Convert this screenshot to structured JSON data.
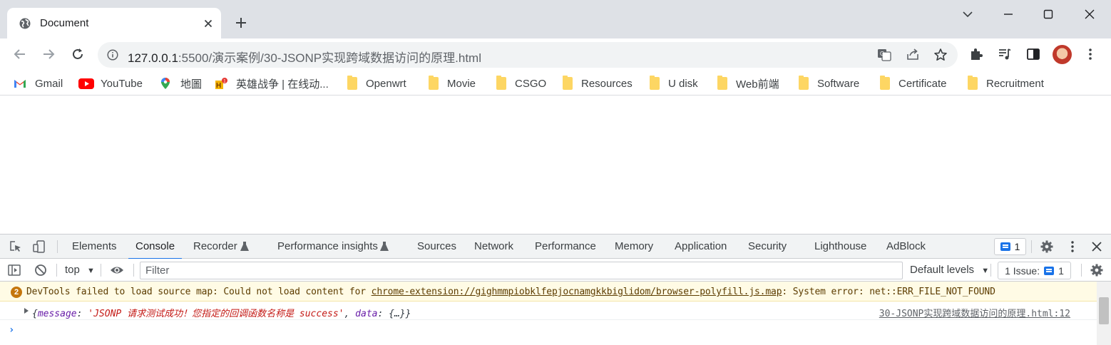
{
  "tab": {
    "title": "Document",
    "favicon": "globe-icon"
  },
  "address": {
    "host": "127.0.0.1",
    "rest": ":5500/演示案例/30-JSONP实现跨域数据访问的原理.html"
  },
  "bookmarks": [
    {
      "label": "Gmail",
      "icon": "gmail-icon"
    },
    {
      "label": "YouTube",
      "icon": "youtube-icon"
    },
    {
      "label": "地圖",
      "icon": "maps-icon"
    },
    {
      "label": "英雄战争 | 在线动...",
      "icon": "game-icon"
    },
    {
      "label": "Openwrt",
      "icon": "folder-icon"
    },
    {
      "label": "Movie",
      "icon": "folder-icon"
    },
    {
      "label": "CSGO",
      "icon": "folder-icon"
    },
    {
      "label": "Resources",
      "icon": "folder-icon"
    },
    {
      "label": "U disk",
      "icon": "folder-icon"
    },
    {
      "label": "Web前端",
      "icon": "folder-icon"
    },
    {
      "label": "Software",
      "icon": "folder-icon"
    },
    {
      "label": "Certificate",
      "icon": "folder-icon"
    },
    {
      "label": "Recruitment",
      "icon": "folder-icon"
    }
  ],
  "devtools": {
    "tabs": [
      "Elements",
      "Console",
      "Recorder",
      "Performance insights",
      "Sources",
      "Network",
      "Performance",
      "Memory",
      "Application",
      "Security",
      "Lighthouse",
      "AdBlock"
    ],
    "active_tab": "Console",
    "message_count": "1",
    "context": "top",
    "filter_placeholder": "Filter",
    "levels": "Default levels",
    "issues_label": "1 Issue:",
    "issues_count": "1",
    "warning": {
      "count": "2",
      "prefix": "DevTools failed to load source map: Could not load content for ",
      "link": "chrome-extension://gighmmpiobklfepjocnamgkkbiglidom/browser-polyfill.js.map",
      "suffix": ": System error: net::ERR_FILE_NOT_FOUND"
    },
    "log": {
      "open": "{",
      "key1": "message",
      "sep1": ": ",
      "value1": "'JSONP 请求测试成功！您指定的回调函数名称是 success'",
      "sep2": ", ",
      "key2": "data",
      "sep3": ": ",
      "value2": "{…}",
      "close": "}",
      "source": "30-JSONP实现跨域数据访问的原理.html:12"
    }
  },
  "colors": {
    "accent": "#1a73e8",
    "tabstrip": "#dee1e6",
    "warning_bg": "#fffbe5"
  }
}
